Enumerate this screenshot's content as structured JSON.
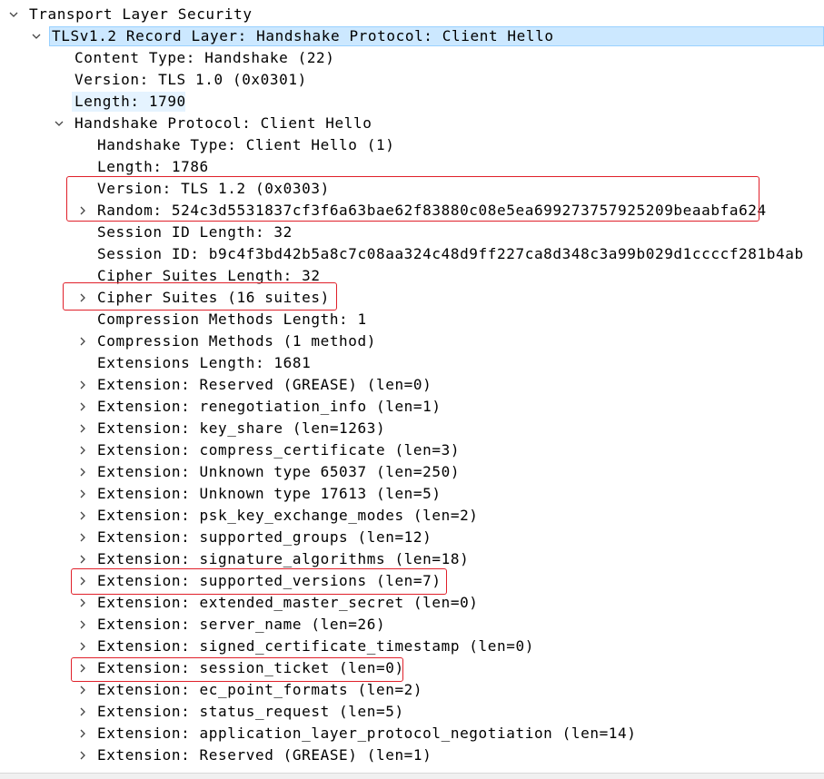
{
  "tree": {
    "root": {
      "label": "Transport Layer Security",
      "expanded": true
    },
    "record": {
      "label": "TLSv1.2 Record Layer: Handshake Protocol: Client Hello",
      "expanded": true
    },
    "record_fields": [
      "Content Type: Handshake (22)",
      "Version: TLS 1.0 (0x0301)",
      "Length: 1790"
    ],
    "handshake": {
      "label": "Handshake Protocol: Client Hello",
      "expanded": true
    },
    "handshake_fields": [
      {
        "label": "Handshake Type: Client Hello (1)",
        "expandable": false
      },
      {
        "label": "Length: 1786",
        "expandable": false
      },
      {
        "label": "Version: TLS 1.2 (0x0303)",
        "expandable": false
      },
      {
        "label": "Random: 524c3d5531837cf3f6a63bae62f83880c08e5ea699273757925209beaabfa624",
        "expandable": true
      },
      {
        "label": "Session ID Length: 32",
        "expandable": false
      },
      {
        "label": "Session ID: b9c4f3bd42b5a8c7c08aa324c48d9ff227ca8d348c3a99b029d1ccccf281b4ab",
        "expandable": false
      },
      {
        "label": "Cipher Suites Length: 32",
        "expandable": false
      },
      {
        "label": "Cipher Suites (16 suites)",
        "expandable": true
      },
      {
        "label": "Compression Methods Length: 1",
        "expandable": false
      },
      {
        "label": "Compression Methods (1 method)",
        "expandable": true
      },
      {
        "label": "Extensions Length: 1681",
        "expandable": false
      },
      {
        "label": "Extension: Reserved (GREASE) (len=0)",
        "expandable": true
      },
      {
        "label": "Extension: renegotiation_info (len=1)",
        "expandable": true
      },
      {
        "label": "Extension: key_share (len=1263)",
        "expandable": true
      },
      {
        "label": "Extension: compress_certificate (len=3)",
        "expandable": true
      },
      {
        "label": "Extension: Unknown type 65037 (len=250)",
        "expandable": true
      },
      {
        "label": "Extension: Unknown type 17613 (len=5)",
        "expandable": true
      },
      {
        "label": "Extension: psk_key_exchange_modes (len=2)",
        "expandable": true
      },
      {
        "label": "Extension: supported_groups (len=12)",
        "expandable": true
      },
      {
        "label": "Extension: signature_algorithms (len=18)",
        "expandable": true
      },
      {
        "label": "Extension: supported_versions (len=7)",
        "expandable": true
      },
      {
        "label": "Extension: extended_master_secret (len=0)",
        "expandable": true
      },
      {
        "label": "Extension: server_name (len=26)",
        "expandable": true
      },
      {
        "label": "Extension: signed_certificate_timestamp (len=0)",
        "expandable": true
      },
      {
        "label": "Extension: session_ticket (len=0)",
        "expandable": true
      },
      {
        "label": "Extension: ec_point_formats (len=2)",
        "expandable": true
      },
      {
        "label": "Extension: status_request (len=5)",
        "expandable": true
      },
      {
        "label": "Extension: application_layer_protocol_negotiation (len=14)",
        "expandable": true
      },
      {
        "label": "Extension: Reserved (GREASE) (len=1)",
        "expandable": true
      }
    ]
  },
  "colors": {
    "selection_bg": "#cce8ff",
    "selection_border": "#99d1ff",
    "highlight_box": "#e0202a"
  }
}
